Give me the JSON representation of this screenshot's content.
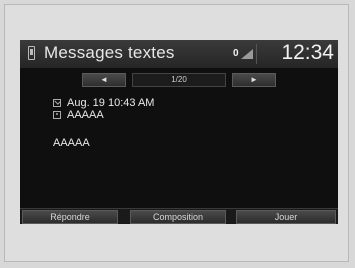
{
  "header": {
    "title": "Messages textes",
    "signal_count": "0",
    "clock": "12:34"
  },
  "pager": {
    "prev_icon": "◄",
    "count": "1/20",
    "next_icon": "►"
  },
  "message": {
    "date": "Aug. 19 10:43 AM",
    "sender": "AAAAA",
    "body": "AAAAA"
  },
  "footer": {
    "reply_label": "Répondre",
    "compose_label": "Composition",
    "play_label": "Jouer"
  },
  "icons": {
    "phone": "phone-icon",
    "signal": "signal-icon",
    "envelope": "envelope-icon",
    "contact": "contact-icon"
  }
}
